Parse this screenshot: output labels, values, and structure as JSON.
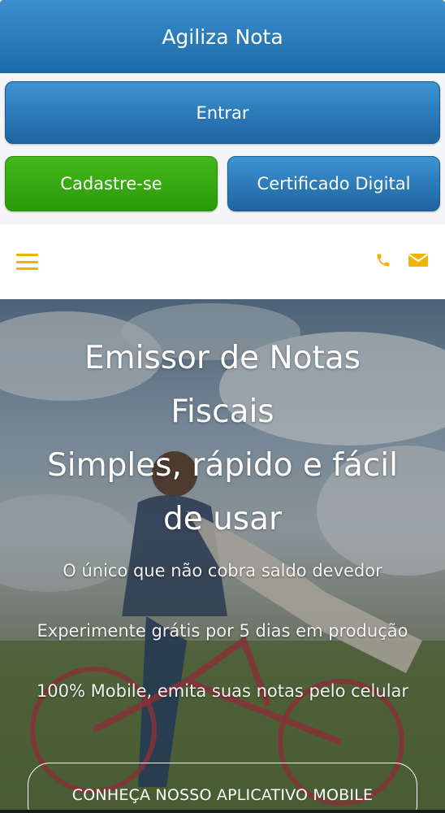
{
  "header": {
    "title": "Agiliza Nota"
  },
  "actions": {
    "login_label": "Entrar",
    "signup_label": "Cadastre-se",
    "certificate_label": "Certificado Digital"
  },
  "nav": {
    "menu_icon": "hamburger-menu-icon",
    "phone_icon": "phone-icon",
    "email_icon": "envelope-icon",
    "accent_color": "#f0b400"
  },
  "hero": {
    "headline_line1": "Emissor de Notas",
    "headline_line2": "Fiscais",
    "headline_line3": "Simples, rápido e fácil",
    "headline_line4": "de usar",
    "sub1": "O único que não cobra saldo devedor",
    "sub2": "Experimente grátis por 5 dias em produção",
    "sub3": "100% Mobile, emita suas notas pelo celular",
    "cta_label": "CONHEÇA NOSSO APLICATIVO MOBILE"
  },
  "colors": {
    "primary_blue": "#1e6aa8",
    "green": "#2c9a0a",
    "accent_yellow": "#f0b400"
  }
}
